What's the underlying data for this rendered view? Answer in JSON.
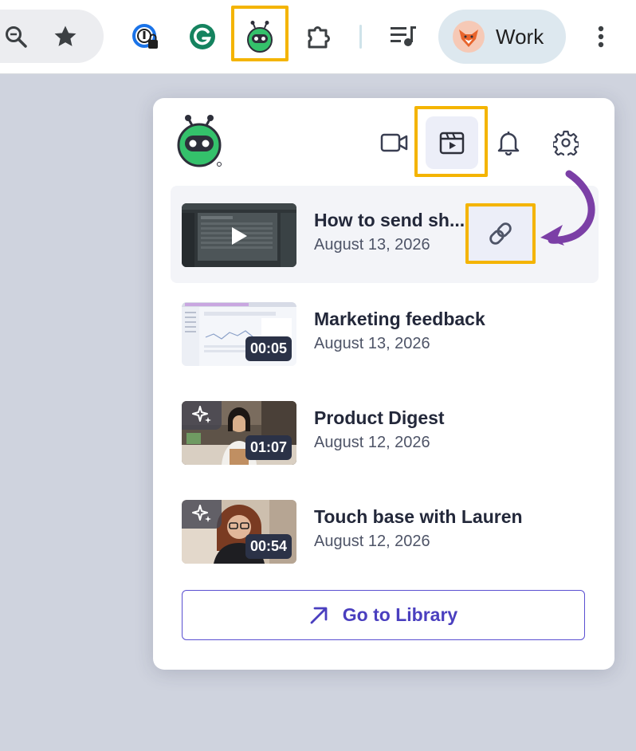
{
  "toolbar": {
    "profile_name": "Work",
    "icons": [
      "zoom-out-icon",
      "star-icon",
      "password-manager-icon",
      "grammarly-icon",
      "loom-extension-icon",
      "extensions-puzzle-icon",
      "media-control-icon",
      "more-vert-icon"
    ]
  },
  "popup": {
    "header_tabs": [
      {
        "name": "record-video-tab",
        "icon": "video-camera-icon"
      },
      {
        "name": "library-tab",
        "icon": "clapperboard-icon",
        "active": true
      },
      {
        "name": "notifications-tab",
        "icon": "bell-icon"
      },
      {
        "name": "settings-tab",
        "icon": "gear-icon"
      }
    ],
    "videos": [
      {
        "title": "How to send sh...",
        "date": "August 13, 2026",
        "duration": "",
        "ai": false,
        "selected": true
      },
      {
        "title": "Marketing feedback",
        "date": "August 13, 2026",
        "duration": "00:05",
        "ai": false,
        "selected": false
      },
      {
        "title": "Product Digest",
        "date": "August 12, 2026",
        "duration": "01:07",
        "ai": true,
        "selected": false
      },
      {
        "title": "Touch base with Lauren",
        "date": "August 12, 2026",
        "duration": "00:54",
        "ai": true,
        "selected": false
      }
    ],
    "library_button": "Go to Library"
  },
  "colors": {
    "highlight": "#f4b400",
    "accent": "#4a3fbf",
    "annotation_arrow": "#7b3fa6",
    "brand_green": "#34c16b"
  }
}
